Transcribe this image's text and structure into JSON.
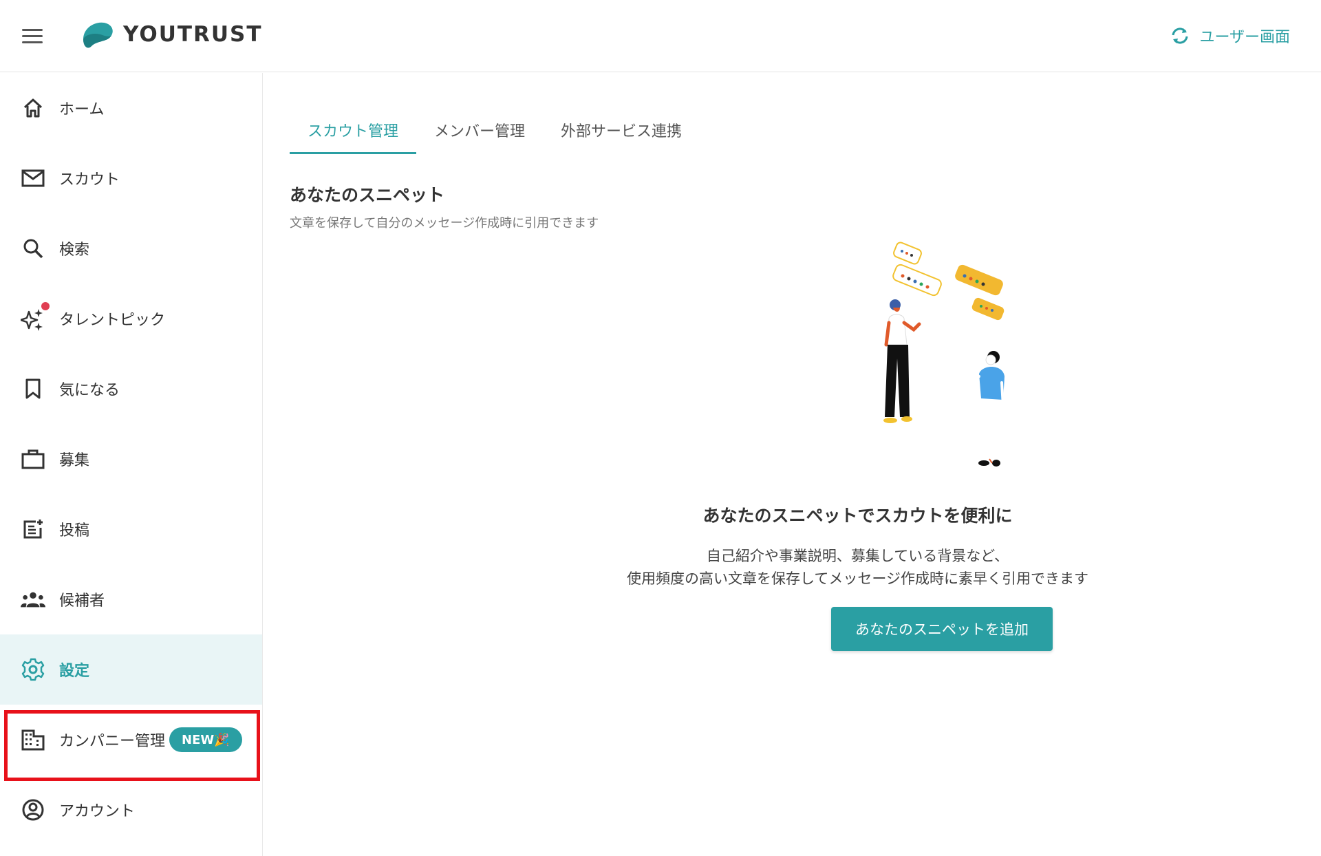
{
  "header": {
    "logo_text": "YOUTRUST",
    "user_screen_label": "ユーザー画面"
  },
  "sidebar": {
    "items": [
      {
        "label": "ホーム",
        "icon": "home-icon"
      },
      {
        "label": "スカウト",
        "icon": "mail-icon"
      },
      {
        "label": "検索",
        "icon": "search-icon"
      },
      {
        "label": "タレントピック",
        "icon": "sparkle-icon"
      },
      {
        "label": "気になる",
        "icon": "bookmark-icon"
      },
      {
        "label": "募集",
        "icon": "briefcase-icon"
      },
      {
        "label": "投稿",
        "icon": "post-add-icon"
      },
      {
        "label": "候補者",
        "icon": "people-icon"
      },
      {
        "label": "設定",
        "icon": "gear-icon"
      },
      {
        "label": "カンパニー管理",
        "icon": "building-icon",
        "badge": "NEW🎉"
      },
      {
        "label": "アカウント",
        "icon": "account-circle-icon"
      }
    ],
    "active_item": "設定"
  },
  "tabs": [
    {
      "label": "スカウト管理"
    },
    {
      "label": "メンバー管理"
    },
    {
      "label": "外部サービス連携"
    }
  ],
  "active_tab": "スカウト管理",
  "section": {
    "title": "あなたのスニペット",
    "description": "文章を保存して自分のメッセージ作成時に引用できます"
  },
  "empty_state": {
    "title": "あなたのスニペットでスカウトを便利に",
    "line1": "自己紹介や事業説明、募集している背景など、",
    "line2": "使用頻度の高い文章を保存してメッセージ作成時に素早く引用できます",
    "button_label": "あなたのスニペットを追加"
  },
  "colors": {
    "accent": "#2a9fa3",
    "active_bg": "#e9f5f6",
    "highlight": "#e8111a"
  }
}
